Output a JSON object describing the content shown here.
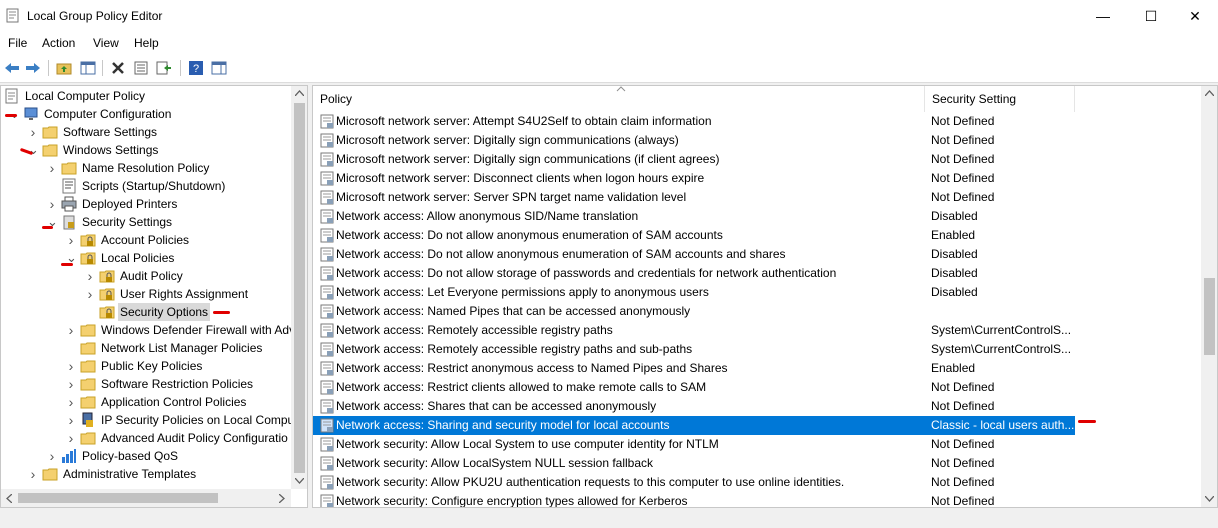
{
  "window": {
    "title": "Local Group Policy Editor",
    "minimize": "—",
    "maximize": "☐",
    "close": "✕"
  },
  "menu": [
    "File",
    "Action",
    "View",
    "Help"
  ],
  "tree": [
    {
      "label": "Local Computer Policy",
      "level": 0,
      "exp": "",
      "icon": "policy-icon"
    },
    {
      "label": "Computer Configuration",
      "level": 1,
      "exp": "v",
      "icon": "computer-icon"
    },
    {
      "label": "Software Settings",
      "level": 2,
      "exp": ">",
      "icon": "folder-icon"
    },
    {
      "label": "Windows Settings",
      "level": 2,
      "exp": "v",
      "icon": "folder-icon"
    },
    {
      "label": "Name Resolution Policy",
      "level": 3,
      "exp": ">",
      "icon": "folder-icon"
    },
    {
      "label": "Scripts (Startup/Shutdown)",
      "level": 3,
      "exp": "",
      "icon": "scripts-icon"
    },
    {
      "label": "Deployed Printers",
      "level": 3,
      "exp": ">",
      "icon": "printer-icon"
    },
    {
      "label": "Security Settings",
      "level": 3,
      "exp": "v",
      "icon": "security-icon"
    },
    {
      "label": "Account Policies",
      "level": 4,
      "exp": ">",
      "icon": "folder-lock-icon"
    },
    {
      "label": "Local Policies",
      "level": 4,
      "exp": "v",
      "icon": "folder-lock-icon"
    },
    {
      "label": "Audit Policy",
      "level": 5,
      "exp": ">",
      "icon": "folder-lock-icon"
    },
    {
      "label": "User Rights Assignment",
      "level": 5,
      "exp": ">",
      "icon": "folder-lock-icon"
    },
    {
      "label": "Security Options",
      "level": 5,
      "exp": "",
      "icon": "folder-lock-icon",
      "selected": true
    },
    {
      "label": "Windows Defender Firewall with Adv",
      "level": 4,
      "exp": ">",
      "icon": "folder-icon"
    },
    {
      "label": "Network List Manager Policies",
      "level": 4,
      "exp": "",
      "icon": "folder-icon"
    },
    {
      "label": "Public Key Policies",
      "level": 4,
      "exp": ">",
      "icon": "folder-icon"
    },
    {
      "label": "Software Restriction Policies",
      "level": 4,
      "exp": ">",
      "icon": "folder-icon"
    },
    {
      "label": "Application Control Policies",
      "level": 4,
      "exp": ">",
      "icon": "folder-icon"
    },
    {
      "label": "IP Security Policies on Local Compu",
      "level": 4,
      "exp": ">",
      "icon": "ipsec-icon"
    },
    {
      "label": "Advanced Audit Policy Configuratio",
      "level": 4,
      "exp": ">",
      "icon": "folder-icon"
    },
    {
      "label": "Policy-based QoS",
      "level": 3,
      "exp": ">",
      "icon": "qos-icon"
    },
    {
      "label": "Administrative Templates",
      "level": 2,
      "exp": ">",
      "icon": "folder-icon"
    }
  ],
  "list": {
    "columns": [
      "Policy",
      "Security Setting"
    ],
    "rows": [
      {
        "policy": "Microsoft network server: Attempt S4U2Self to obtain claim information",
        "setting": "Not Defined"
      },
      {
        "policy": "Microsoft network server: Digitally sign communications (always)",
        "setting": "Not Defined"
      },
      {
        "policy": "Microsoft network server: Digitally sign communications (if client agrees)",
        "setting": "Not Defined"
      },
      {
        "policy": "Microsoft network server: Disconnect clients when logon hours expire",
        "setting": "Not Defined"
      },
      {
        "policy": "Microsoft network server: Server SPN target name validation level",
        "setting": "Not Defined"
      },
      {
        "policy": "Network access: Allow anonymous SID/Name translation",
        "setting": "Disabled"
      },
      {
        "policy": "Network access: Do not allow anonymous enumeration of SAM accounts",
        "setting": "Enabled"
      },
      {
        "policy": "Network access: Do not allow anonymous enumeration of SAM accounts and shares",
        "setting": "Disabled"
      },
      {
        "policy": "Network access: Do not allow storage of passwords and credentials for network authentication",
        "setting": "Disabled"
      },
      {
        "policy": "Network access: Let Everyone permissions apply to anonymous users",
        "setting": "Disabled"
      },
      {
        "policy": "Network access: Named Pipes that can be accessed anonymously",
        "setting": ""
      },
      {
        "policy": "Network access: Remotely accessible registry paths",
        "setting": "System\\CurrentControlS..."
      },
      {
        "policy": "Network access: Remotely accessible registry paths and sub-paths",
        "setting": "System\\CurrentControlS..."
      },
      {
        "policy": "Network access: Restrict anonymous access to Named Pipes and Shares",
        "setting": "Enabled"
      },
      {
        "policy": "Network access: Restrict clients allowed to make remote calls to SAM",
        "setting": "Not Defined"
      },
      {
        "policy": "Network access: Shares that can be accessed anonymously",
        "setting": "Not Defined"
      },
      {
        "policy": "Network access: Sharing and security model for local accounts",
        "setting": "Classic - local users auth...",
        "selected": true
      },
      {
        "policy": "Network security: Allow Local System to use computer identity for NTLM",
        "setting": "Not Defined"
      },
      {
        "policy": "Network security: Allow LocalSystem NULL session fallback",
        "setting": "Not Defined"
      },
      {
        "policy": "Network security: Allow PKU2U authentication requests to this computer to use online identities.",
        "setting": "Not Defined"
      },
      {
        "policy": "Network security: Configure encryption types allowed for Kerberos",
        "setting": "Not Defined"
      }
    ]
  },
  "colors": {
    "selection": "#0078d7",
    "annotation": "#e00000"
  }
}
